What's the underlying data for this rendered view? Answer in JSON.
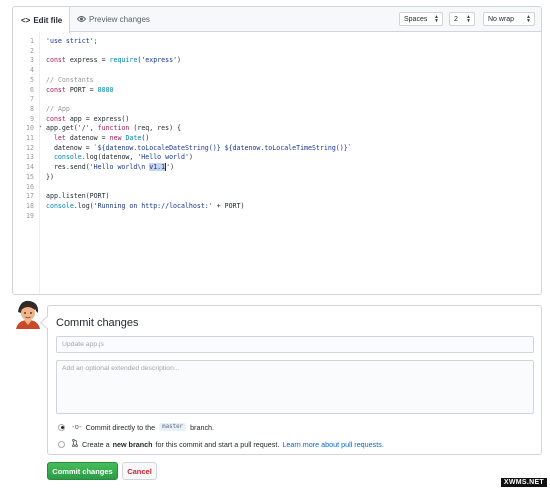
{
  "toolbar": {
    "edit_tab": "Edit file",
    "preview_tab": "Preview changes",
    "indent_mode": "Spaces",
    "indent_size": "2",
    "wrap_mode": "No wrap"
  },
  "code": {
    "line_numbers": [
      "1",
      "2",
      "3",
      "4",
      "5",
      "6",
      "7",
      "8",
      "9",
      "10",
      "11",
      "12",
      "13",
      "14",
      "15",
      "16",
      "17",
      "18",
      "19"
    ],
    "lines": [
      "'use strict';",
      "",
      "const express = require('express')",
      "",
      "// Constants",
      "const PORT = 8080",
      "",
      "// App",
      "const app = express()",
      "app.get('/', function (req, res) {",
      "  let datenow = new Date()",
      "  datenow = `${datenow.toLocaleDateString()} ${datenow.toLocaleTimeString()}`",
      "  console.log(datenow, 'Hello world')",
      "  res.send('Hello world\\n v1.1')",
      "})",
      "",
      "app.listen(PORT)",
      "console.log('Running on http://localhost:' + PORT)",
      ""
    ]
  },
  "commit": {
    "title": "Commit changes",
    "summary_placeholder": "Update app.js",
    "description_placeholder": "Add an optional extended description...",
    "option_direct_prefix": "Commit directly to the",
    "branch_name": "master",
    "option_direct_suffix": "branch.",
    "option_new_prefix": "Create a",
    "option_new_bold": "new branch",
    "option_new_suffix": "for this commit and start a pull request.",
    "option_new_link": "Learn more about pull requests.",
    "commit_button": "Commit changes",
    "cancel_button": "Cancel"
  },
  "watermark": "XWMS.NET",
  "icons": {
    "edit_tab": "code-icon",
    "preview_tab": "eye-icon",
    "direct_option": "git-commit-icon",
    "new_branch_option": "git-pull-request-icon"
  },
  "colors": {
    "commit_button": "#2c9b46",
    "cancel_text": "#cb2431",
    "link": "#0366d6"
  }
}
